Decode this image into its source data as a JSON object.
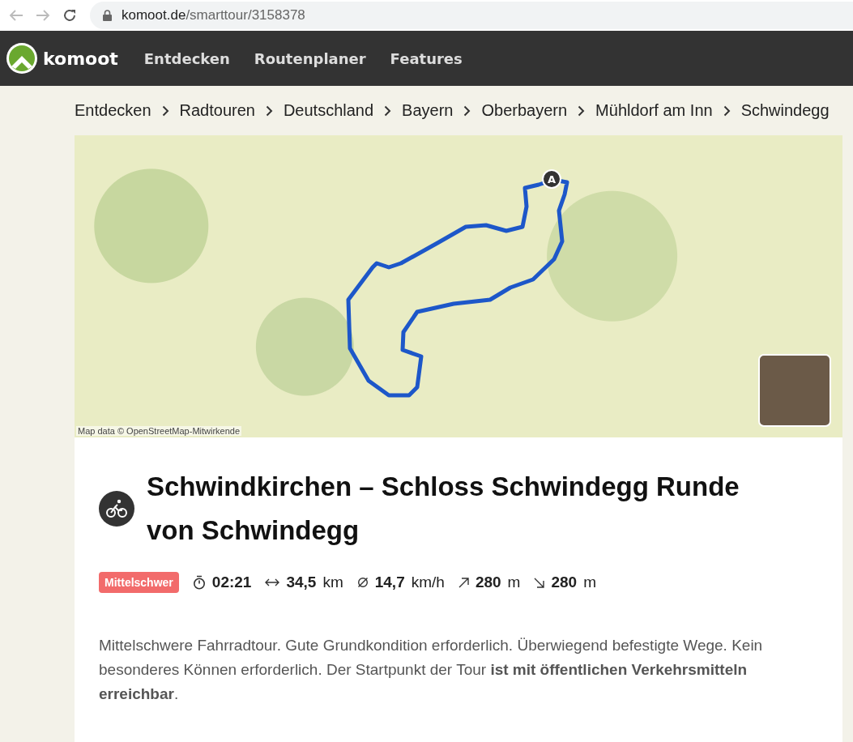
{
  "browser": {
    "url_host": "komoot.de",
    "url_path": "/smarttour/3158378"
  },
  "nav": {
    "brand": "komoot",
    "items": [
      "Entdecken",
      "Routenplaner",
      "Features"
    ]
  },
  "breadcrumbs": [
    "Entdecken",
    "Radtouren",
    "Deutschland",
    "Bayern",
    "Oberbayern",
    "Mühldorf am Inn",
    "Schwindegg"
  ],
  "map": {
    "start_marker": "A",
    "attribution": "Map data © OpenStreetMap-Mitwirkende"
  },
  "tour": {
    "title": "Schwindkirchen – Schloss Schwindegg Runde von Schwindegg",
    "difficulty": "Mittelschwer",
    "stats": [
      {
        "kind": "duration",
        "value": "02:21"
      },
      {
        "kind": "distance",
        "value": "34,5",
        "unit": "km"
      },
      {
        "kind": "speed",
        "value": "14,7",
        "unit": "km/h"
      },
      {
        "kind": "uphill",
        "value": "280",
        "unit": "m"
      },
      {
        "kind": "downhill",
        "value": "280",
        "unit": "m"
      }
    ],
    "description": "Mittelschwere Fahrradtour. Gute Grundkondition erforderlich. Überwiegend befestigte Wege. Kein besonderes Können erforderlich. Der Startpunkt der Tour **ist mit öffentlichen Verkehrsmitteln erreichbar**."
  }
}
